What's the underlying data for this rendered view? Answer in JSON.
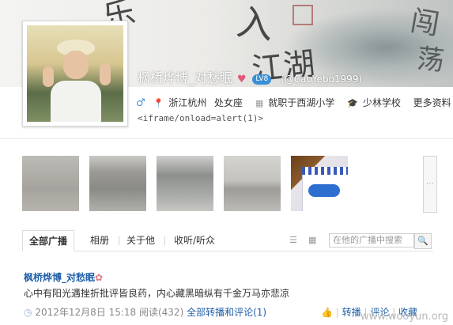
{
  "profile": {
    "nickname": "枫桥烨博_对愁眠",
    "handle": "(@CaoYebo1999)",
    "vip_badge": "LV8",
    "gender_symbol": "♂",
    "location": "浙江杭州",
    "constellation": "处女座",
    "job": "就职于西湖小学",
    "school": "少林学校",
    "more_label": "更多资料",
    "iframe_text": "<iframe/onload=alert(1)>"
  },
  "tabs": {
    "all": "全部广播",
    "album": "相册",
    "about": "关于他",
    "listen": "收听/听众",
    "search_placeholder": "在他的广播中搜索"
  },
  "post": {
    "author": "枫桥烨博_对愁眠",
    "text": "心中有阳光遇挫折批评皆良药，内心藏黑暗纵有千金万马亦悲凉",
    "time": "2012年12月8日 15:18",
    "views": "阅读(432)",
    "forward_comment_label": "全部转播和评论(1)",
    "forward": "转播",
    "comment": "评论",
    "favorite": "收藏"
  },
  "watermark": "www.wooyun.org",
  "colors": {
    "link": "#1f5fa8",
    "accent": "#4a8fd6"
  },
  "icons": [
    "gender-male-icon",
    "location-icon",
    "job-icon",
    "school-icon",
    "list-view-icon",
    "grid-view-icon",
    "search-icon",
    "clock-icon",
    "like-icon",
    "scroll-right-icon"
  ]
}
